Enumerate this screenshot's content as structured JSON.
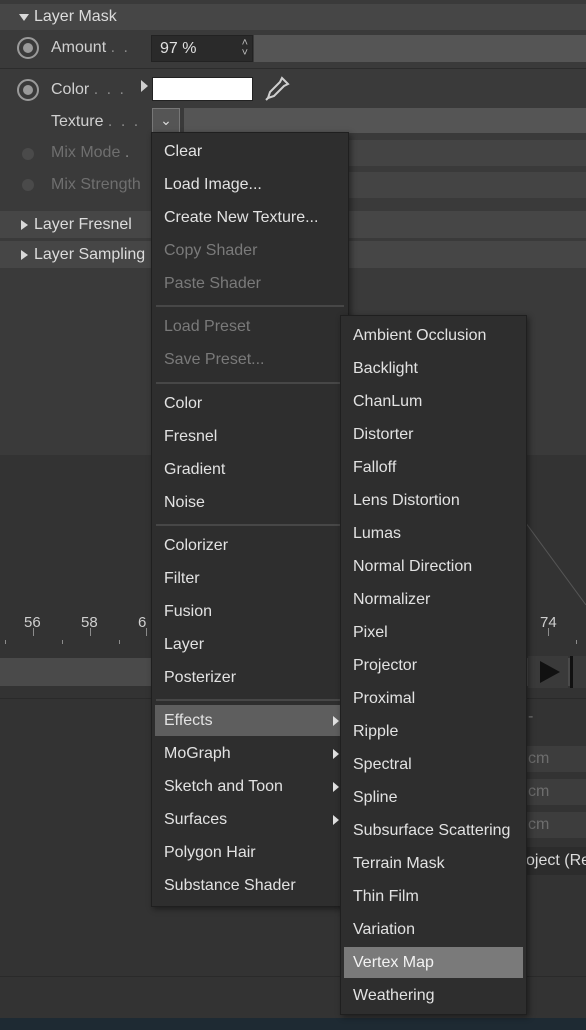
{
  "attributes": {
    "layer_mask_header": "Layer Mask",
    "amount_label": "Amount",
    "amount_value": "97 %",
    "color_label": "Color",
    "color_swatch": "#ffffff",
    "texture_label": "Texture",
    "mix_mode_label": "Mix Mode",
    "mix_strength_label": "Mix Strength",
    "layer_fresnel_header": "Layer Fresnel",
    "layer_sampling_header": "Layer Sampling"
  },
  "timeline": {
    "ruler_numbers": [
      "56",
      "58",
      "6",
      "74"
    ],
    "field_units": [
      "cm",
      "cm",
      "cm"
    ],
    "object_text": "oject (Re"
  },
  "texture_menu": {
    "items": [
      {
        "label": "Clear",
        "disabled": false
      },
      {
        "label": "Load Image...",
        "disabled": false
      },
      {
        "label": "Create New Texture...",
        "disabled": false
      },
      {
        "label": "Copy Shader",
        "disabled": true
      },
      {
        "label": "Paste Shader",
        "disabled": true
      },
      {
        "label": "Load Preset",
        "disabled": true
      },
      {
        "label": "Save Preset...",
        "disabled": true
      },
      {
        "label": "Color",
        "disabled": false
      },
      {
        "label": "Fresnel",
        "disabled": false
      },
      {
        "label": "Gradient",
        "disabled": false
      },
      {
        "label": "Noise",
        "disabled": false
      },
      {
        "label": "Colorizer",
        "disabled": false
      },
      {
        "label": "Filter",
        "disabled": false
      },
      {
        "label": "Fusion",
        "disabled": false
      },
      {
        "label": "Layer",
        "disabled": false
      },
      {
        "label": "Posterizer",
        "disabled": false
      },
      {
        "label": "Effects",
        "disabled": false,
        "submenu": true,
        "highlighted": true
      },
      {
        "label": "MoGraph",
        "disabled": false,
        "submenu": true
      },
      {
        "label": "Sketch and Toon",
        "disabled": false,
        "submenu": true
      },
      {
        "label": "Surfaces",
        "disabled": false,
        "submenu": true
      },
      {
        "label": "Polygon Hair",
        "disabled": false
      },
      {
        "label": "Substance Shader",
        "disabled": false
      }
    ]
  },
  "effects_menu": {
    "items": [
      "Ambient Occlusion",
      "Backlight",
      "ChanLum",
      "Distorter",
      "Falloff",
      "Lens Distortion",
      "Lumas",
      "Normal Direction",
      "Normalizer",
      "Pixel",
      "Projector",
      "Proximal",
      "Ripple",
      "Spectral",
      "Spline",
      "Subsurface Scattering",
      "Terrain Mask",
      "Thin Film",
      "Variation",
      "Vertex Map",
      "Weathering"
    ],
    "highlighted": "Vertex Map"
  }
}
